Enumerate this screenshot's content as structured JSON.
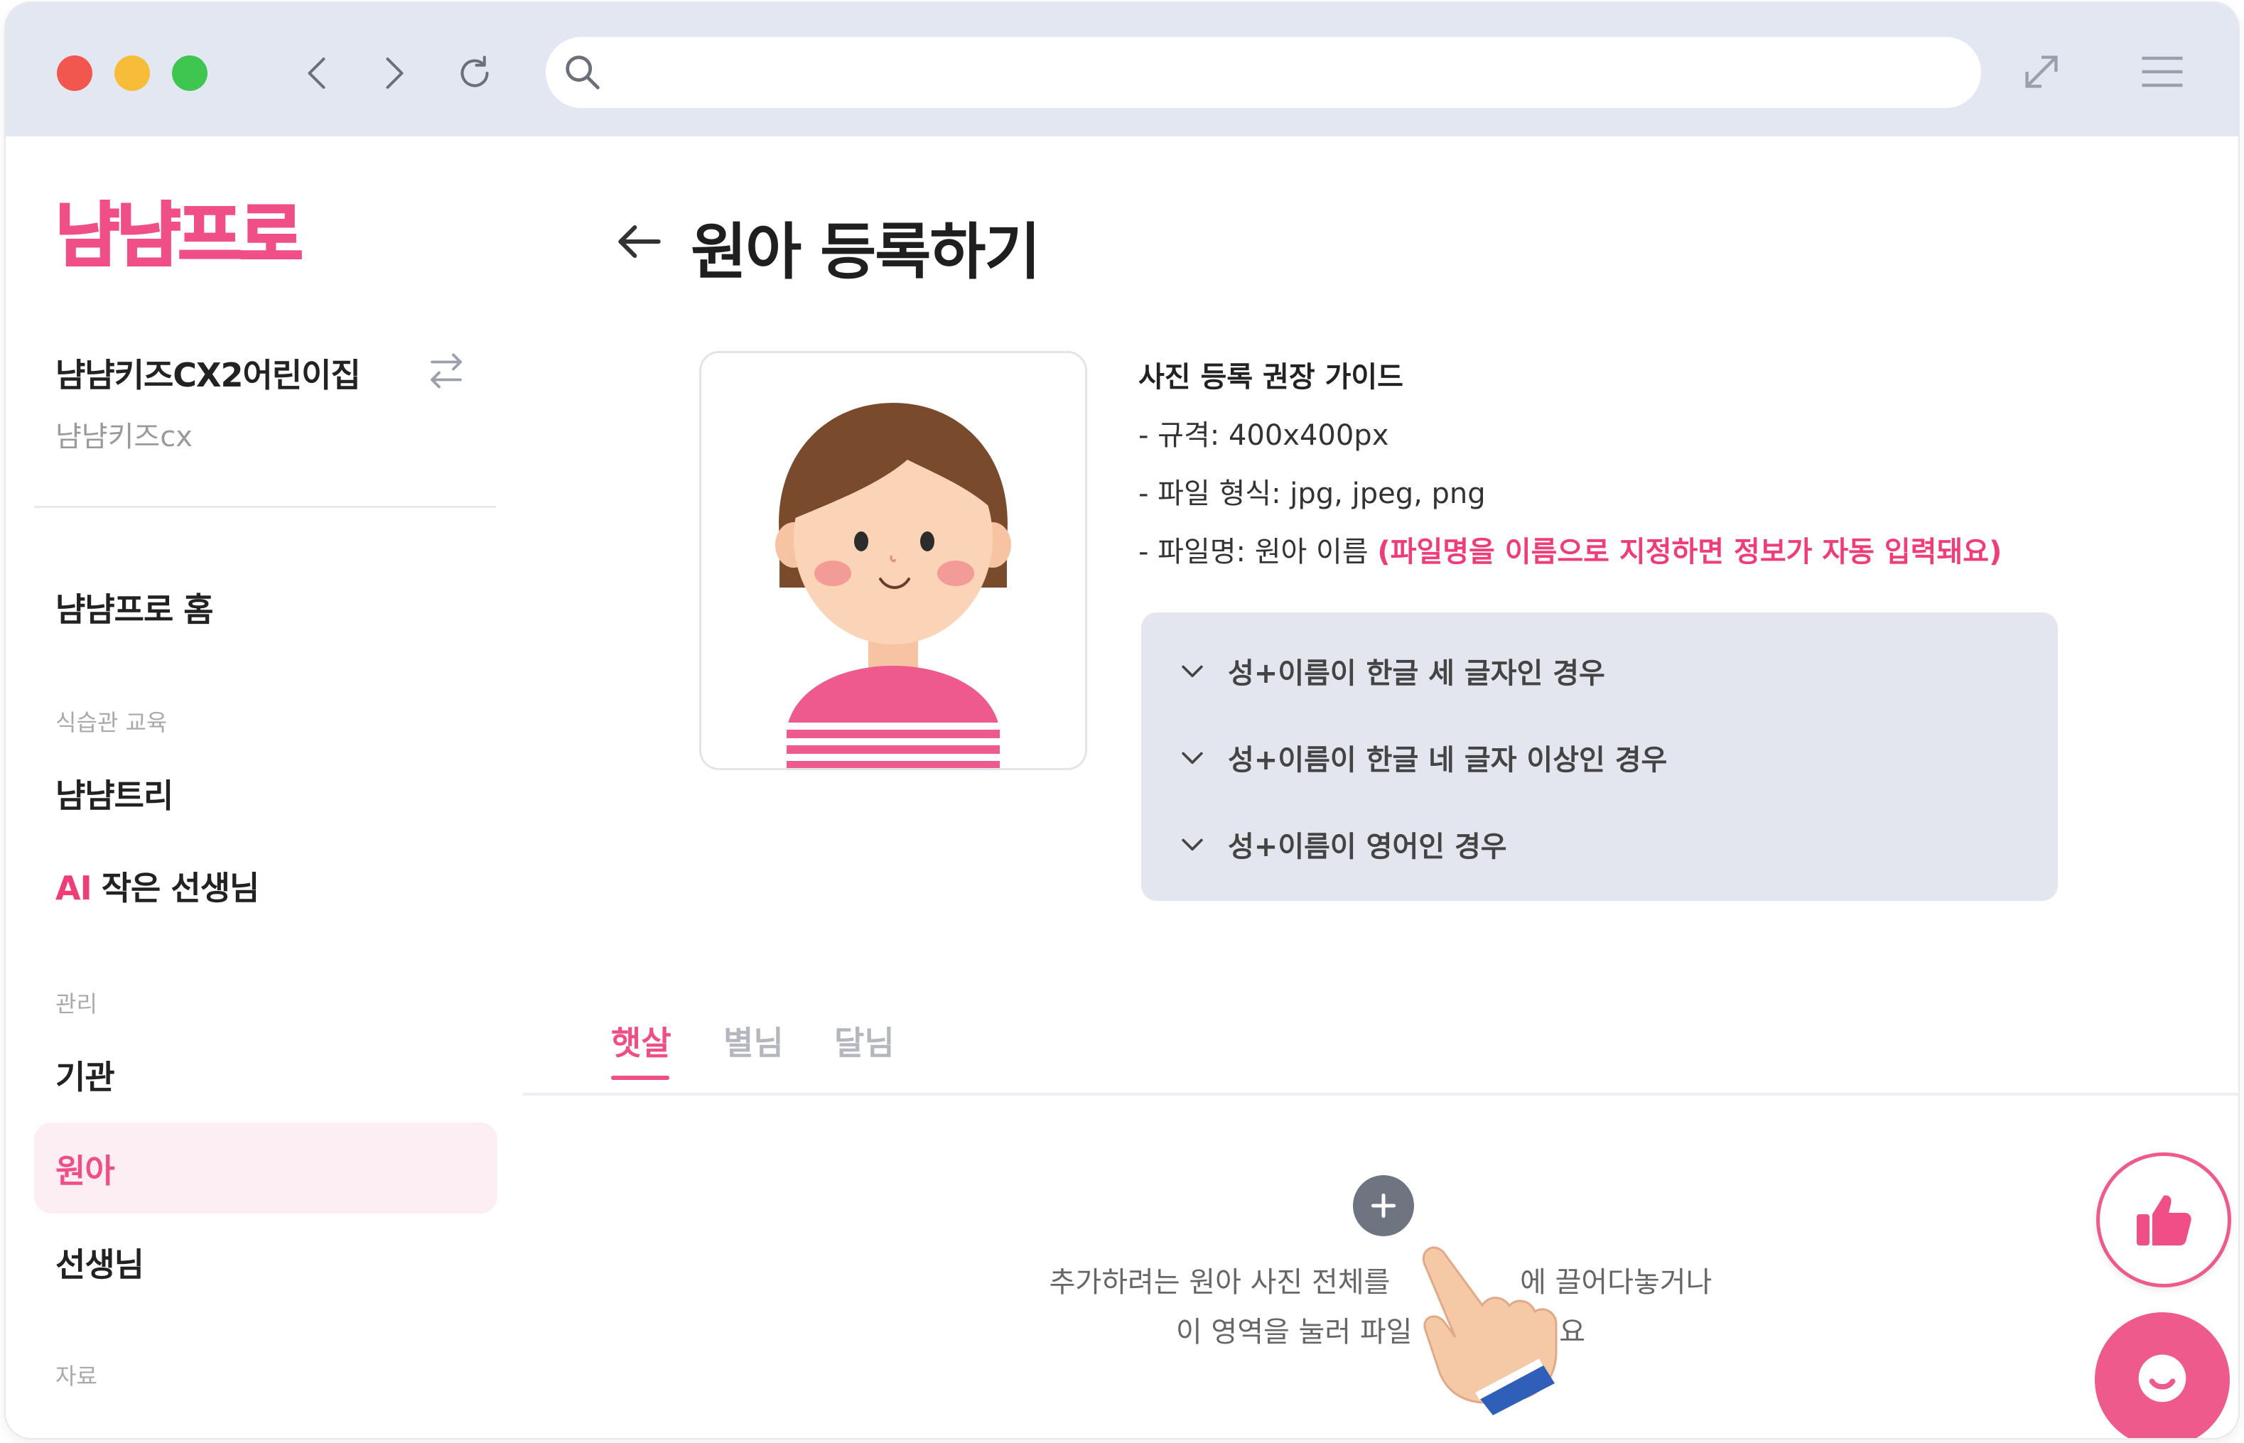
{
  "browser": {
    "url_value": "",
    "controls": [
      "back-icon",
      "forward-icon",
      "reload-icon",
      "search-icon",
      "expand-icon",
      "menu-icon"
    ]
  },
  "sidebar": {
    "logo": "냠냠프로",
    "org_name": "냠냠키즈CX2어린이집",
    "org_sub": "냠냠키즈cx",
    "home": "냠냠프로 홈",
    "section_education": "식습관 교육",
    "nyamtree": "냠냠트리",
    "ai_tag": "AI",
    "ai_teacher": "작은 선생님",
    "section_manage": "관리",
    "institution": "기관",
    "children": "원아",
    "teachers": "선생님",
    "section_materials": "자료"
  },
  "main": {
    "title": "원아 등록하기",
    "guide": {
      "title": "사진 등록 권장 가이드",
      "spec": "- 규격: 400x400px",
      "format": "- 파일 형식: jpg, jpeg, png",
      "filename_prefix": "- 파일명: 원아 이름 ",
      "filename_highlight": "(파일명을 이름으로 지정하면 정보가 자동 입력돼요)"
    },
    "accordion": [
      "성+이름이 한글 세 글자인 경우",
      "성+이름이 한글 네 글자 이상인 경우",
      "성+이름이 영어인 경우"
    ],
    "tabs": [
      "햇살",
      "별님",
      "달님"
    ],
    "dropzone": {
      "line1": "추가하려는 원아 사진 전체를 ",
      "line1_end": "에 끌어다놓거나",
      "line2": "이 영역을 눌러 파일",
      "line2_end": "세요"
    }
  },
  "colors": {
    "brand_pink": "#ef4e86",
    "chrome_bg": "#e3e7f2",
    "accordion_bg": "#e3e6ee"
  }
}
